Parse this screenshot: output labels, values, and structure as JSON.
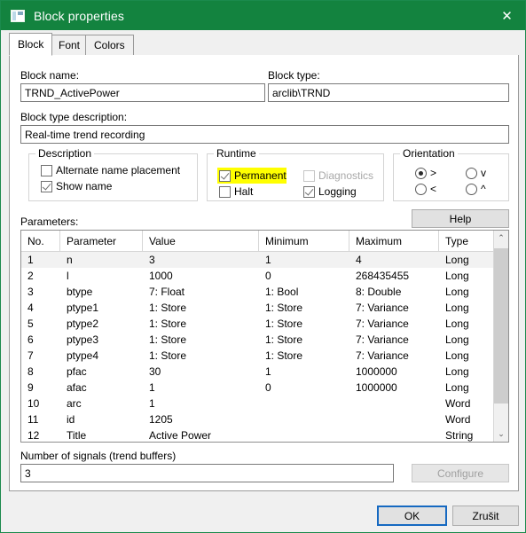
{
  "window": {
    "title": "Block properties",
    "icon": "window-form-icon",
    "close_label": "✕",
    "accent_color": "#13833f"
  },
  "tabs": [
    {
      "label": "Block",
      "active": true
    },
    {
      "label": "Font",
      "active": false
    },
    {
      "label": "Colors",
      "active": false
    }
  ],
  "fields": {
    "block_name_label": "Block name:",
    "block_name_value": "TRND_ActivePower",
    "block_type_label": "Block type:",
    "block_type_value": "arclib\\TRND",
    "block_type_desc_label": "Block type description:",
    "block_type_desc_value": "Real-time trend recording"
  },
  "description_group": {
    "title": "Description",
    "items": [
      {
        "label": "Alternate name placement",
        "checked": false,
        "disabled": false
      },
      {
        "label": "Show name",
        "checked": true,
        "disabled": false
      }
    ]
  },
  "runtime_group": {
    "title": "Runtime",
    "items": [
      {
        "label": "Permanent",
        "checked": true,
        "disabled": false,
        "highlighted": true
      },
      {
        "label": "Halt",
        "checked": false,
        "disabled": false,
        "highlighted": false
      },
      {
        "label": "Diagnostics",
        "checked": false,
        "disabled": true,
        "highlighted": false
      },
      {
        "label": "Logging",
        "checked": true,
        "disabled": false,
        "highlighted": false
      }
    ],
    "highlight_color": "#ffff00"
  },
  "orientation_group": {
    "title": "Orientation",
    "items": [
      {
        "label": ">",
        "selected": true
      },
      {
        "label": "<",
        "selected": false
      },
      {
        "label": "v",
        "selected": false
      },
      {
        "label": "^",
        "selected": false
      }
    ]
  },
  "parameters": {
    "label": "Parameters:",
    "help_label": "Help",
    "columns": [
      "No.",
      "Parameter",
      "Value",
      "Minimum",
      "Maximum",
      "Type"
    ],
    "rows": [
      {
        "no": "1",
        "parameter": "n",
        "value": "3",
        "minimum": "1",
        "maximum": "4",
        "type": "Long",
        "selected": true
      },
      {
        "no": "2",
        "parameter": "l",
        "value": "1000",
        "minimum": "0",
        "maximum": "268435455",
        "type": "Long",
        "selected": false
      },
      {
        "no": "3",
        "parameter": "btype",
        "value": "7: Float",
        "minimum": "1: Bool",
        "maximum": "8: Double",
        "type": "Long",
        "selected": false
      },
      {
        "no": "4",
        "parameter": "ptype1",
        "value": "1: Store",
        "minimum": "1: Store",
        "maximum": "7: Variance",
        "type": "Long",
        "selected": false
      },
      {
        "no": "5",
        "parameter": "ptype2",
        "value": "1: Store",
        "minimum": "1: Store",
        "maximum": "7: Variance",
        "type": "Long",
        "selected": false
      },
      {
        "no": "6",
        "parameter": "ptype3",
        "value": "1: Store",
        "minimum": "1: Store",
        "maximum": "7: Variance",
        "type": "Long",
        "selected": false
      },
      {
        "no": "7",
        "parameter": "ptype4",
        "value": "1: Store",
        "minimum": "1: Store",
        "maximum": "7: Variance",
        "type": "Long",
        "selected": false
      },
      {
        "no": "8",
        "parameter": "pfac",
        "value": "30",
        "minimum": "1",
        "maximum": "1000000",
        "type": "Long",
        "selected": false
      },
      {
        "no": "9",
        "parameter": "afac",
        "value": "1",
        "minimum": "0",
        "maximum": "1000000",
        "type": "Long",
        "selected": false
      },
      {
        "no": "10",
        "parameter": "arc",
        "value": "1",
        "minimum": "",
        "maximum": "",
        "type": "Word",
        "selected": false
      },
      {
        "no": "11",
        "parameter": "id",
        "value": "1205",
        "minimum": "",
        "maximum": "",
        "type": "Word",
        "selected": false
      },
      {
        "no": "12",
        "parameter": "Title",
        "value": "Active Power",
        "minimum": "",
        "maximum": "",
        "type": "String",
        "selected": false
      }
    ],
    "scrollbar": {
      "up_arrow": "⌃",
      "down_arrow": "⌄"
    }
  },
  "signals": {
    "label": "Number of signals (trend buffers)",
    "value": "3",
    "configure_label": "Configure",
    "configure_disabled": true
  },
  "footer": {
    "ok_label": "OK",
    "cancel_label": "Zrušit",
    "focus_color": "#1669c1"
  }
}
